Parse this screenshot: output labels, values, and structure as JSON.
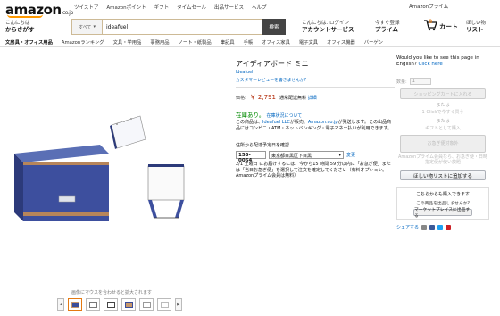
{
  "header": {
    "logo": "amazon",
    "logo_suffix": ".co.jp",
    "topnav": [
      "ツイストア",
      "Amazonポイント",
      "ギフト",
      "タイムセール",
      "出品サービス",
      "ヘルプ"
    ],
    "prime_promo": "Amazonプライム",
    "greet_small": "こんにちは",
    "greet_big": "からさがす",
    "search_cat": "すべて",
    "search_value": "ideafuel",
    "search_button": "検索",
    "account_small": "こんにちは. ログイン",
    "account_big": "アカウントサービス",
    "prime_small": "今すぐ登録",
    "prime_big": "プライム",
    "cart_count": "0",
    "cart_label": "カート",
    "wishlist_small": "ほしい物",
    "wishlist_big": "リスト"
  },
  "subnav": [
    "文房具・オフィス用品",
    "Amazonランキング",
    "文具・学用品",
    "事務用品",
    "ノート・紙製品",
    "筆記具",
    "手帳",
    "オフィス家具",
    "電子文具",
    "オフィス機器",
    "バーゲン"
  ],
  "product": {
    "title": "アイディアボード ミニ",
    "brand": "Ideafuel",
    "reviews": "カスタマーレビューを書きませんか?",
    "price_label": "価格:",
    "price": "￥ 2,791",
    "price_note": "通常配送無料",
    "price_detail": "詳細",
    "stock": "在庫あり。",
    "stock_note": "在庫状況について",
    "ship_line1": "この商品は、",
    "ship_seller": "Ideafuel LLC",
    "ship_line2": "が販売、",
    "ship_amazon": "Amazon.co.jp",
    "ship_line3": "が発送します。",
    "ship_line4": "この出品商品にはコンビニ・ATM・ネットバンキング・電子マネー払いが利用できます。",
    "deliv_head": "住所から配達予定日を確認",
    "zip": "153-0064",
    "pref": "東京都目黒区下目黒",
    "change": "変更",
    "deliv_text": "2/1 土曜日 にお届けするには、今から15 時間 59 分以内に「お急ぎ便」または「当日お急ぎ便」を選択して注文を確定してください（有料オプション。Amazonプライム会員は無料）"
  },
  "buybox": {
    "lang_q": "Would you like to see this page in English?",
    "lang_link": "Click here",
    "qty_label": "数量:",
    "qty": "1",
    "add_cart": "ショッピングカートに入れる",
    "or1": "または",
    "one_click": "1-Clickで今すぐ買う",
    "or2": "または",
    "gift": "ギフトとして購入",
    "dis_btn2": "お急ぎ便対象外",
    "gray_note": "Amazonプライム会員なら、お急ぎ便・日時指定便が使い放題",
    "wishlist": "ほしい物リストに追加する",
    "sell_q": "こちらからも購入できます",
    "sell_sub": "この商品を出品しませんか?",
    "sell_btn": "マーケットプレイスに出品する",
    "share": "シェアする"
  },
  "gallery": {
    "caption": "画像にマウスを合わせると拡大されます",
    "thumb_count": 6
  },
  "colors": {
    "price": "#b12704",
    "link": "#0066c0",
    "stock": "#008a00",
    "accent": "#e47911"
  }
}
